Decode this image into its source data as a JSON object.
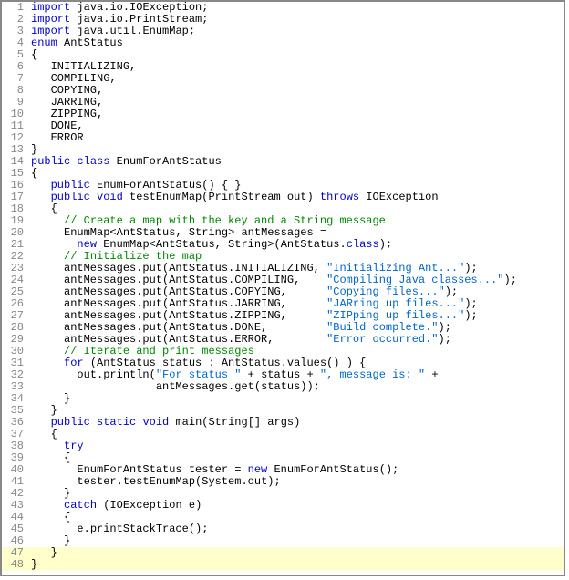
{
  "lines": [
    {
      "n": 1,
      "h": [
        [
          "kw",
          "import"
        ],
        [
          "plain",
          " java"
        ],
        [
          "plain",
          "."
        ],
        [
          "plain",
          "io"
        ],
        [
          "plain",
          "."
        ],
        [
          "plain",
          "IOException"
        ],
        [
          "plain",
          ";"
        ]
      ]
    },
    {
      "n": 2,
      "h": [
        [
          "kw",
          "import"
        ],
        [
          "plain",
          " java"
        ],
        [
          "plain",
          "."
        ],
        [
          "plain",
          "io"
        ],
        [
          "plain",
          "."
        ],
        [
          "plain",
          "PrintStream"
        ],
        [
          "plain",
          ";"
        ]
      ]
    },
    {
      "n": 3,
      "h": [
        [
          "kw",
          "import"
        ],
        [
          "plain",
          " java"
        ],
        [
          "plain",
          "."
        ],
        [
          "plain",
          "util"
        ],
        [
          "plain",
          "."
        ],
        [
          "plain",
          "EnumMap"
        ],
        [
          "plain",
          ";"
        ]
      ]
    },
    {
      "n": 4,
      "h": [
        [
          "kw",
          "enum"
        ],
        [
          "plain",
          " AntStatus"
        ]
      ]
    },
    {
      "n": 5,
      "h": [
        [
          "plain",
          "{"
        ]
      ]
    },
    {
      "n": 6,
      "h": [
        [
          "plain",
          "   INITIALIZING"
        ],
        [
          "plain",
          ","
        ]
      ]
    },
    {
      "n": 7,
      "h": [
        [
          "plain",
          "   COMPILING"
        ],
        [
          "plain",
          ","
        ]
      ]
    },
    {
      "n": 8,
      "h": [
        [
          "plain",
          "   COPYING"
        ],
        [
          "plain",
          ","
        ]
      ]
    },
    {
      "n": 9,
      "h": [
        [
          "plain",
          "   JARRING"
        ],
        [
          "plain",
          ","
        ]
      ]
    },
    {
      "n": 10,
      "h": [
        [
          "plain",
          "   ZIPPING"
        ],
        [
          "plain",
          ","
        ]
      ]
    },
    {
      "n": 11,
      "h": [
        [
          "plain",
          "   DONE"
        ],
        [
          "plain",
          ","
        ]
      ]
    },
    {
      "n": 12,
      "h": [
        [
          "plain",
          "   ERROR"
        ]
      ]
    },
    {
      "n": 13,
      "h": [
        [
          "plain",
          "}"
        ]
      ]
    },
    {
      "n": 14,
      "h": [
        [
          "kw",
          "public"
        ],
        [
          "plain",
          " "
        ],
        [
          "kw",
          "class"
        ],
        [
          "plain",
          " EnumForAntStatus"
        ]
      ]
    },
    {
      "n": 15,
      "h": [
        [
          "plain",
          "{"
        ]
      ]
    },
    {
      "n": 16,
      "h": [
        [
          "plain",
          "   "
        ],
        [
          "kw",
          "public"
        ],
        [
          "plain",
          " EnumForAntStatus"
        ],
        [
          "plain",
          "()"
        ],
        [
          "plain",
          " "
        ],
        [
          "plain",
          "{"
        ],
        [
          "plain",
          " "
        ],
        [
          "plain",
          "}"
        ]
      ]
    },
    {
      "n": 17,
      "h": [
        [
          "plain",
          "   "
        ],
        [
          "kw",
          "public"
        ],
        [
          "plain",
          " "
        ],
        [
          "kw",
          "void"
        ],
        [
          "plain",
          " testEnumMap"
        ],
        [
          "plain",
          "("
        ],
        [
          "plain",
          "PrintStream out"
        ],
        [
          "plain",
          ")"
        ],
        [
          "plain",
          " "
        ],
        [
          "kw",
          "throws"
        ],
        [
          "plain",
          " IOException"
        ]
      ]
    },
    {
      "n": 18,
      "h": [
        [
          "plain",
          "   "
        ],
        [
          "plain",
          "{"
        ]
      ]
    },
    {
      "n": 19,
      "h": [
        [
          "plain",
          "     "
        ],
        [
          "com",
          "// Create a map with the key and a String message"
        ]
      ]
    },
    {
      "n": 20,
      "h": [
        [
          "plain",
          "     EnumMap"
        ],
        [
          "plain",
          "<"
        ],
        [
          "plain",
          "AntStatus"
        ],
        [
          "plain",
          ","
        ],
        [
          "plain",
          " String"
        ],
        [
          "plain",
          ">"
        ],
        [
          "plain",
          " antMessages "
        ],
        [
          "plain",
          "="
        ]
      ]
    },
    {
      "n": 21,
      "h": [
        [
          "plain",
          "       "
        ],
        [
          "kw",
          "new"
        ],
        [
          "plain",
          " EnumMap"
        ],
        [
          "plain",
          "<"
        ],
        [
          "plain",
          "AntStatus"
        ],
        [
          "plain",
          ","
        ],
        [
          "plain",
          " String"
        ],
        [
          "plain",
          ">"
        ],
        [
          "plain",
          "("
        ],
        [
          "plain",
          "AntStatus"
        ],
        [
          "plain",
          "."
        ],
        [
          "kw",
          "class"
        ],
        [
          "plain",
          ")"
        ],
        [
          "plain",
          ";"
        ]
      ]
    },
    {
      "n": 22,
      "h": [
        [
          "plain",
          "     "
        ],
        [
          "com",
          "// Initialize the map"
        ]
      ]
    },
    {
      "n": 23,
      "h": [
        [
          "plain",
          "     antMessages"
        ],
        [
          "plain",
          "."
        ],
        [
          "plain",
          "put"
        ],
        [
          "plain",
          "("
        ],
        [
          "plain",
          "AntStatus"
        ],
        [
          "plain",
          "."
        ],
        [
          "plain",
          "INITIALIZING"
        ],
        [
          "plain",
          ","
        ],
        [
          "plain",
          " "
        ],
        [
          "str",
          "\"Initializing Ant...\""
        ],
        [
          "plain",
          ")"
        ],
        [
          "plain",
          ";"
        ]
      ]
    },
    {
      "n": 24,
      "h": [
        [
          "plain",
          "     antMessages"
        ],
        [
          "plain",
          "."
        ],
        [
          "plain",
          "put"
        ],
        [
          "plain",
          "("
        ],
        [
          "plain",
          "AntStatus"
        ],
        [
          "plain",
          "."
        ],
        [
          "plain",
          "COMPILING"
        ],
        [
          "plain",
          ","
        ],
        [
          "plain",
          "    "
        ],
        [
          "str",
          "\"Compiling Java classes...\""
        ],
        [
          "plain",
          ")"
        ],
        [
          "plain",
          ";"
        ]
      ]
    },
    {
      "n": 25,
      "h": [
        [
          "plain",
          "     antMessages"
        ],
        [
          "plain",
          "."
        ],
        [
          "plain",
          "put"
        ],
        [
          "plain",
          "("
        ],
        [
          "plain",
          "AntStatus"
        ],
        [
          "plain",
          "."
        ],
        [
          "plain",
          "COPYING"
        ],
        [
          "plain",
          ","
        ],
        [
          "plain",
          "      "
        ],
        [
          "str",
          "\"Copying files...\""
        ],
        [
          "plain",
          ")"
        ],
        [
          "plain",
          ";"
        ]
      ]
    },
    {
      "n": 26,
      "h": [
        [
          "plain",
          "     antMessages"
        ],
        [
          "plain",
          "."
        ],
        [
          "plain",
          "put"
        ],
        [
          "plain",
          "("
        ],
        [
          "plain",
          "AntStatus"
        ],
        [
          "plain",
          "."
        ],
        [
          "plain",
          "JARRING"
        ],
        [
          "plain",
          ","
        ],
        [
          "plain",
          "      "
        ],
        [
          "str",
          "\"JARring up files...\""
        ],
        [
          "plain",
          ")"
        ],
        [
          "plain",
          ";"
        ]
      ]
    },
    {
      "n": 27,
      "h": [
        [
          "plain",
          "     antMessages"
        ],
        [
          "plain",
          "."
        ],
        [
          "plain",
          "put"
        ],
        [
          "plain",
          "("
        ],
        [
          "plain",
          "AntStatus"
        ],
        [
          "plain",
          "."
        ],
        [
          "plain",
          "ZIPPING"
        ],
        [
          "plain",
          ","
        ],
        [
          "plain",
          "      "
        ],
        [
          "str",
          "\"ZIPping up files...\""
        ],
        [
          "plain",
          ")"
        ],
        [
          "plain",
          ";"
        ]
      ]
    },
    {
      "n": 28,
      "h": [
        [
          "plain",
          "     antMessages"
        ],
        [
          "plain",
          "."
        ],
        [
          "plain",
          "put"
        ],
        [
          "plain",
          "("
        ],
        [
          "plain",
          "AntStatus"
        ],
        [
          "plain",
          "."
        ],
        [
          "plain",
          "DONE"
        ],
        [
          "plain",
          ","
        ],
        [
          "plain",
          "         "
        ],
        [
          "str",
          "\"Build complete.\""
        ],
        [
          "plain",
          ")"
        ],
        [
          "plain",
          ";"
        ]
      ]
    },
    {
      "n": 29,
      "h": [
        [
          "plain",
          "     antMessages"
        ],
        [
          "plain",
          "."
        ],
        [
          "plain",
          "put"
        ],
        [
          "plain",
          "("
        ],
        [
          "plain",
          "AntStatus"
        ],
        [
          "plain",
          "."
        ],
        [
          "plain",
          "ERROR"
        ],
        [
          "plain",
          ","
        ],
        [
          "plain",
          "        "
        ],
        [
          "str",
          "\"Error occurred.\""
        ],
        [
          "plain",
          ")"
        ],
        [
          "plain",
          ";"
        ]
      ]
    },
    {
      "n": 30,
      "h": [
        [
          "plain",
          "     "
        ],
        [
          "com",
          "// Iterate and print messages"
        ]
      ]
    },
    {
      "n": 31,
      "h": [
        [
          "plain",
          "     "
        ],
        [
          "kw",
          "for"
        ],
        [
          "plain",
          " "
        ],
        [
          "plain",
          "("
        ],
        [
          "plain",
          "AntStatus status "
        ],
        [
          "plain",
          ":"
        ],
        [
          "plain",
          " AntStatus"
        ],
        [
          "plain",
          "."
        ],
        [
          "plain",
          "values"
        ],
        [
          "plain",
          "("
        ],
        [
          "plain",
          ")"
        ],
        [
          "plain",
          " "
        ],
        [
          "plain",
          ")"
        ],
        [
          "plain",
          " "
        ],
        [
          "plain",
          "{"
        ]
      ]
    },
    {
      "n": 32,
      "h": [
        [
          "plain",
          "       out"
        ],
        [
          "plain",
          "."
        ],
        [
          "plain",
          "println"
        ],
        [
          "plain",
          "("
        ],
        [
          "str",
          "\"For status \""
        ],
        [
          "plain",
          " "
        ],
        [
          "plain",
          "+"
        ],
        [
          "plain",
          " status "
        ],
        [
          "plain",
          "+"
        ],
        [
          "plain",
          " "
        ],
        [
          "str",
          "\", message is: \""
        ],
        [
          "plain",
          " "
        ],
        [
          "plain",
          "+"
        ]
      ]
    },
    {
      "n": 33,
      "h": [
        [
          "plain",
          "                   antMessages"
        ],
        [
          "plain",
          "."
        ],
        [
          "plain",
          "get"
        ],
        [
          "plain",
          "("
        ],
        [
          "plain",
          "status"
        ],
        [
          "plain",
          ")"
        ],
        [
          "plain",
          ")"
        ],
        [
          "plain",
          ";"
        ]
      ]
    },
    {
      "n": 34,
      "h": [
        [
          "plain",
          "     "
        ],
        [
          "plain",
          "}"
        ]
      ]
    },
    {
      "n": 35,
      "h": [
        [
          "plain",
          "   "
        ],
        [
          "plain",
          "}"
        ]
      ]
    },
    {
      "n": 36,
      "h": [
        [
          "plain",
          "   "
        ],
        [
          "kw",
          "public"
        ],
        [
          "plain",
          " "
        ],
        [
          "kw",
          "static"
        ],
        [
          "plain",
          " "
        ],
        [
          "kw",
          "void"
        ],
        [
          "plain",
          " main"
        ],
        [
          "plain",
          "("
        ],
        [
          "plain",
          "String"
        ],
        [
          "plain",
          "["
        ],
        [
          "plain",
          "]"
        ],
        [
          "plain",
          " args"
        ],
        [
          "plain",
          ")"
        ]
      ]
    },
    {
      "n": 37,
      "h": [
        [
          "plain",
          "   "
        ],
        [
          "plain",
          "{"
        ]
      ]
    },
    {
      "n": 38,
      "h": [
        [
          "plain",
          "     "
        ],
        [
          "kw",
          "try"
        ]
      ]
    },
    {
      "n": 39,
      "h": [
        [
          "plain",
          "     "
        ],
        [
          "plain",
          "{"
        ]
      ]
    },
    {
      "n": 40,
      "h": [
        [
          "plain",
          "       EnumForAntStatus tester "
        ],
        [
          "plain",
          "="
        ],
        [
          "plain",
          " "
        ],
        [
          "kw",
          "new"
        ],
        [
          "plain",
          " EnumForAntStatus"
        ],
        [
          "plain",
          "("
        ],
        [
          "plain",
          ")"
        ],
        [
          "plain",
          ";"
        ]
      ]
    },
    {
      "n": 41,
      "h": [
        [
          "plain",
          "       tester"
        ],
        [
          "plain",
          "."
        ],
        [
          "plain",
          "testEnumMap"
        ],
        [
          "plain",
          "("
        ],
        [
          "plain",
          "System"
        ],
        [
          "plain",
          "."
        ],
        [
          "plain",
          "out"
        ],
        [
          "plain",
          ")"
        ],
        [
          "plain",
          ";"
        ]
      ]
    },
    {
      "n": 42,
      "h": [
        [
          "plain",
          "     "
        ],
        [
          "plain",
          "}"
        ]
      ]
    },
    {
      "n": 43,
      "h": [
        [
          "plain",
          "     "
        ],
        [
          "kw",
          "catch"
        ],
        [
          "plain",
          " "
        ],
        [
          "plain",
          "("
        ],
        [
          "plain",
          "IOException e"
        ],
        [
          "plain",
          ")"
        ]
      ]
    },
    {
      "n": 44,
      "h": [
        [
          "plain",
          "     "
        ],
        [
          "plain",
          "{"
        ]
      ]
    },
    {
      "n": 45,
      "h": [
        [
          "plain",
          "       e"
        ],
        [
          "plain",
          "."
        ],
        [
          "plain",
          "printStackTrace"
        ],
        [
          "plain",
          "("
        ],
        [
          "plain",
          ")"
        ],
        [
          "plain",
          ";"
        ]
      ]
    },
    {
      "n": 46,
      "h": [
        [
          "plain",
          "     "
        ],
        [
          "plain",
          "}"
        ]
      ]
    },
    {
      "n": 47,
      "h": [
        [
          "plain",
          "   "
        ],
        [
          "plain",
          "}"
        ]
      ],
      "hl": true
    },
    {
      "n": 48,
      "h": [
        [
          "plain",
          "}"
        ]
      ],
      "hl": true
    }
  ]
}
